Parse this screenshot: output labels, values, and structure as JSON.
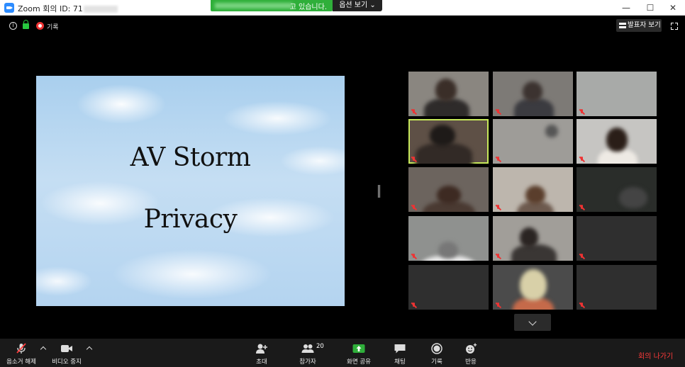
{
  "window": {
    "title": "Zoom 회의 ID: 71",
    "controls": [
      "—",
      "☐",
      "✕"
    ]
  },
  "share_banner": {
    "suffix_text": "고 있습니다.",
    "view_options_label": "옵션 보기"
  },
  "top_bar": {
    "recording_label": "기록",
    "speaker_view_label": "발표자 보기"
  },
  "shared_screen": {
    "line1": "AV Storm",
    "line2": "Privacy"
  },
  "gallery": {
    "tiles": [
      {
        "name": "",
        "bg": "#8a8680"
      },
      {
        "name": "",
        "bg": "#7d7a76"
      },
      {
        "name": "",
        "bg": "#a8aaa8"
      },
      {
        "name": "",
        "bg": "#5e5046",
        "highlight": true
      },
      {
        "name": "",
        "bg": "#9e9c98"
      },
      {
        "name": "",
        "bg": "#c6c5c2"
      },
      {
        "name": "",
        "bg": "#6c645e"
      },
      {
        "name": "",
        "bg": "#bdb6ad"
      },
      {
        "name": "",
        "bg": "#2a2d2a"
      },
      {
        "name": "",
        "bg": "#8f918f"
      },
      {
        "name": "",
        "bg": "#a19e99"
      },
      {
        "name": "",
        "bg": "#2f2f2f"
      },
      {
        "name": "",
        "bg": "#2f2f2f"
      },
      {
        "name": "",
        "bg": "#4b4b4b"
      },
      {
        "name": "",
        "bg": "#2f2f2f"
      }
    ]
  },
  "toolbar": {
    "unmute_label": "음소거 해제",
    "video_label": "비디오 중지",
    "invite_label": "초대",
    "participants_label": "참가자",
    "participants_count": "20",
    "share_label": "화면 공유",
    "chat_label": "채팅",
    "record_label": "기록",
    "reaction_label": "반응",
    "leave_label": "회의 나가기"
  },
  "colors": {
    "accent_green": "#2faf3a",
    "leave_red": "#ff3b3b",
    "speaker_highlight": "#c7e85a"
  }
}
